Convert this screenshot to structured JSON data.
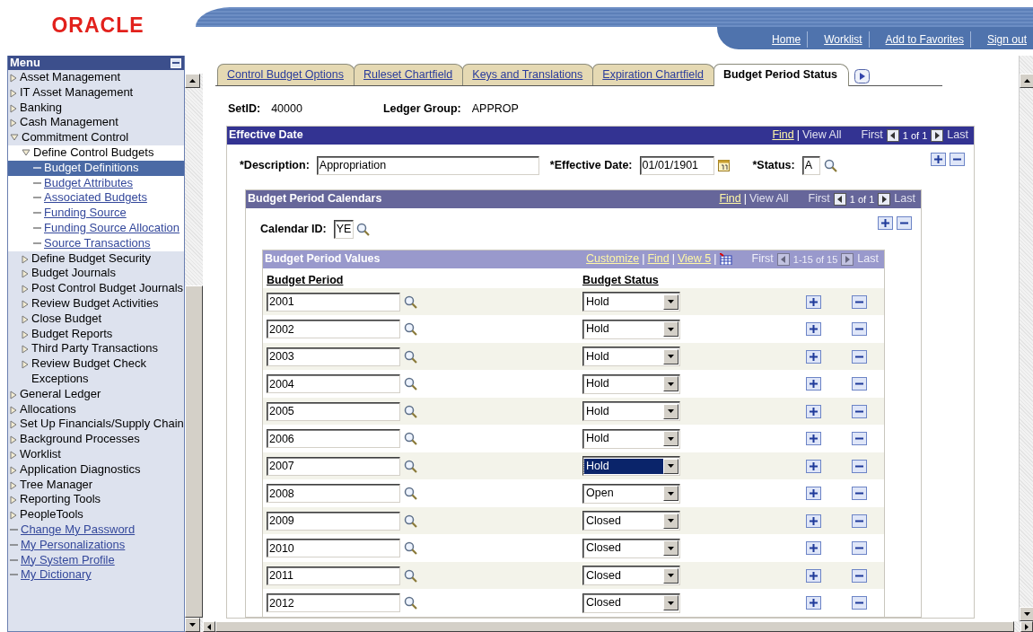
{
  "header": {
    "logo": "ORACLE",
    "links": [
      "Home",
      "Worklist",
      "Add to Favorites",
      "Sign out"
    ]
  },
  "menu": {
    "title": "Menu",
    "items": [
      {
        "label": "Asset Management",
        "kind": "folder",
        "expanded": false
      },
      {
        "label": "IT Asset Management",
        "kind": "folder",
        "expanded": false
      },
      {
        "label": "Banking",
        "kind": "folder",
        "expanded": false
      },
      {
        "label": "Cash Management",
        "kind": "folder",
        "expanded": false
      },
      {
        "label": "Commitment Control",
        "kind": "folder",
        "expanded": true,
        "children": [
          {
            "label": "Define Control Budgets",
            "kind": "folder",
            "expanded": true,
            "children": [
              {
                "label": "Budget Definitions",
                "kind": "link",
                "selected": true
              },
              {
                "label": "Budget Attributes",
                "kind": "link",
                "selected": false
              },
              {
                "label": "Associated Budgets",
                "kind": "link",
                "selected": false
              },
              {
                "label": "Funding Source",
                "kind": "link",
                "selected": false
              },
              {
                "label": "Funding Source Allocation",
                "kind": "link",
                "selected": false
              },
              {
                "label": "Source Transactions",
                "kind": "link",
                "selected": false
              }
            ]
          },
          {
            "label": "Define Budget Security",
            "kind": "folder",
            "expanded": false
          },
          {
            "label": "Budget Journals",
            "kind": "folder",
            "expanded": false
          },
          {
            "label": "Post Control Budget Journals",
            "kind": "folder",
            "expanded": false
          },
          {
            "label": "Review Budget Activities",
            "kind": "folder",
            "expanded": false
          },
          {
            "label": "Close Budget",
            "kind": "folder",
            "expanded": false
          },
          {
            "label": "Budget Reports",
            "kind": "folder",
            "expanded": false
          },
          {
            "label": "Third Party Transactions",
            "kind": "folder",
            "expanded": false
          },
          {
            "label": "Review Budget Check Exceptions",
            "kind": "folder",
            "expanded": false
          }
        ]
      },
      {
        "label": "General Ledger",
        "kind": "folder",
        "expanded": false
      },
      {
        "label": "Allocations",
        "kind": "folder",
        "expanded": false
      },
      {
        "label": "Set Up Financials/Supply Chain",
        "kind": "folder",
        "expanded": false
      },
      {
        "label": "Background Processes",
        "kind": "folder",
        "expanded": false
      },
      {
        "label": "Worklist",
        "kind": "folder",
        "expanded": false
      },
      {
        "label": "Application Diagnostics",
        "kind": "folder",
        "expanded": false
      },
      {
        "label": "Tree Manager",
        "kind": "folder",
        "expanded": false
      },
      {
        "label": "Reporting Tools",
        "kind": "folder",
        "expanded": false
      },
      {
        "label": "PeopleTools",
        "kind": "folder",
        "expanded": false
      },
      {
        "label": "Change My Password",
        "kind": "link",
        "selected": false
      },
      {
        "label": "My Personalizations",
        "kind": "link",
        "selected": false
      },
      {
        "label": "My System Profile",
        "kind": "link",
        "selected": false
      },
      {
        "label": "My Dictionary",
        "kind": "link",
        "selected": false
      }
    ]
  },
  "tabs": [
    {
      "label": "Control Budget Options",
      "selected": false
    },
    {
      "label": "Ruleset Chartfield",
      "selected": false
    },
    {
      "label": "Keys and Translations",
      "selected": false
    },
    {
      "label": "Expiration Chartfield",
      "selected": false
    },
    {
      "label": "Budget Period Status",
      "selected": true
    }
  ],
  "keys": [
    {
      "label": "SetID:",
      "value": "40000"
    },
    {
      "label": "Ledger Group:",
      "value": "APPROP"
    }
  ],
  "effective_date": {
    "title": "Effective Date",
    "separator": "|",
    "links": [
      {
        "text": "Find",
        "enabled": true
      },
      {
        "text": "View All",
        "enabled": false
      }
    ],
    "nav": {
      "first": "First",
      "count": "1 of 1",
      "last": "Last",
      "disabled": false
    },
    "description": {
      "label": "*Description:",
      "value": "Appropriation"
    },
    "date": {
      "label": "*Effective Date:",
      "value": "01/01/1901"
    },
    "status": {
      "label": "*Status:",
      "value": "A"
    }
  },
  "calendars": {
    "title": "Budget Period Calendars",
    "separator": "|",
    "links": [
      {
        "text": "Find",
        "enabled": true
      },
      {
        "text": "View All",
        "enabled": false
      }
    ],
    "nav": {
      "first": "First",
      "count": "1 of 1",
      "last": "Last",
      "disabled": false
    },
    "calendar_id": {
      "label": "Calendar ID:",
      "value": "YE"
    }
  },
  "period_values": {
    "title": "Budget Period Values",
    "separator": "|",
    "links": [
      {
        "text": "Customize",
        "enabled": true
      },
      {
        "text": "Find",
        "enabled": true
      },
      {
        "text": "View 5",
        "enabled": true
      }
    ],
    "nav": {
      "first": "First",
      "count": "1-15 of 15",
      "last": "Last",
      "disabled": true
    },
    "columns": [
      "Budget Period",
      "Budget Status"
    ],
    "rows": [
      {
        "period": "2001",
        "status": "Hold",
        "focused": false
      },
      {
        "period": "2002",
        "status": "Hold",
        "focused": false
      },
      {
        "period": "2003",
        "status": "Hold",
        "focused": false
      },
      {
        "period": "2004",
        "status": "Hold",
        "focused": false
      },
      {
        "period": "2005",
        "status": "Hold",
        "focused": false
      },
      {
        "period": "2006",
        "status": "Hold",
        "focused": false
      },
      {
        "period": "2007",
        "status": "Hold",
        "focused": true
      },
      {
        "period": "2008",
        "status": "Open",
        "focused": false
      },
      {
        "period": "2009",
        "status": "Closed",
        "focused": false
      },
      {
        "period": "2010",
        "status": "Closed",
        "focused": false
      },
      {
        "period": "2011",
        "status": "Closed",
        "focused": false
      },
      {
        "period": "2012",
        "status": "Closed",
        "focused": false
      }
    ]
  }
}
